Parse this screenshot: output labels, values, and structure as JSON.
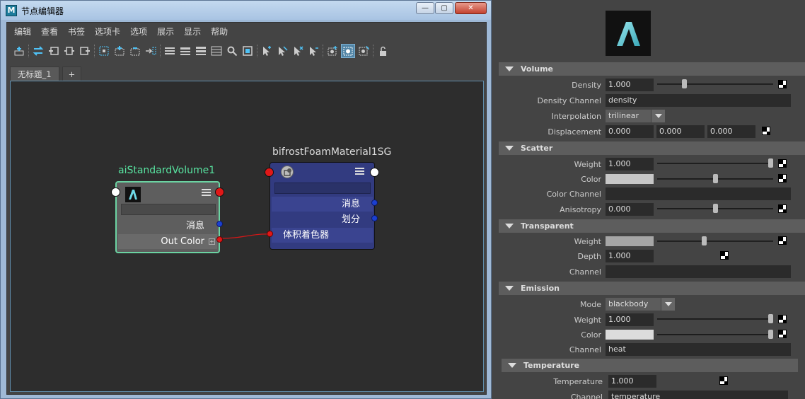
{
  "window": {
    "title": "节点编辑器",
    "app_icon_letter": "M",
    "minimize": "—",
    "maximize": "▢",
    "close": "✕"
  },
  "menu": [
    "编辑",
    "查看",
    "书签",
    "选项卡",
    "选项",
    "展示",
    "显示",
    "帮助"
  ],
  "tabs": {
    "active": "无标题_1",
    "add": "+"
  },
  "nodes": {
    "standard_volume": {
      "title": "aiStandardVolume1",
      "row1": "消息",
      "row2": "Out Color",
      "title_color": "#58e3a0"
    },
    "foam_sg": {
      "title": "bifrostFoamMaterial1SG",
      "row1": "消息",
      "row2": "划分",
      "row3": "体积着色器"
    }
  },
  "attributes": {
    "volume": {
      "header": "Volume",
      "density_label": "Density",
      "density_value": "1.000",
      "density_level": 0.22,
      "density_channel_label": "Density Channel",
      "density_channel_value": "density",
      "interpolation_label": "Interpolation",
      "interpolation_value": "trilinear",
      "displacement_label": "Displacement",
      "displacement_x": "0.000",
      "displacement_y": "0.000",
      "displacement_z": "0.000"
    },
    "scatter": {
      "header": "Scatter",
      "weight_label": "Weight",
      "weight_value": "1.000",
      "weight_level": 1.0,
      "color_label": "Color",
      "color_value": "#c7c7c7",
      "color_level": 0.5,
      "color_channel_label": "Color Channel",
      "color_channel_value": "",
      "anisotropy_label": "Anisotropy",
      "anisotropy_value": "0.000",
      "anisotropy_level": 0.5
    },
    "transparent": {
      "header": "Transparent",
      "weight_label": "Weight",
      "weight_color": "#a6a6a6",
      "weight_level": 0.4,
      "depth_label": "Depth",
      "depth_value": "1.000",
      "channel_label": "Channel",
      "channel_value": ""
    },
    "emission": {
      "header": "Emission",
      "mode_label": "Mode",
      "mode_value": "blackbody",
      "weight_label": "Weight",
      "weight_value": "1.000",
      "weight_level": 1.0,
      "color_label": "Color",
      "color_value": "#dcdcdc",
      "color_level": 1.0,
      "channel_label": "Channel",
      "channel_value": "heat"
    },
    "temperature": {
      "header": "Temperature",
      "temperature_label": "Temperature",
      "temperature_value": "1.000",
      "channel_label": "Channel",
      "channel_value": "temperature"
    }
  }
}
